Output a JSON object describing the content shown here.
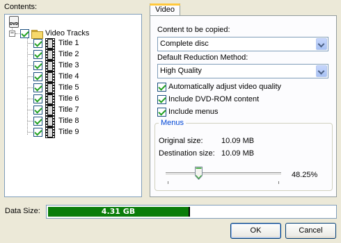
{
  "contents": {
    "label": "Contents:",
    "disc_icon_text": "DVD",
    "root": {
      "label": "Video Tracks",
      "checked": true,
      "expanded": true,
      "expander": "−"
    },
    "titles": [
      {
        "label": "Title 1",
        "checked": true
      },
      {
        "label": "Title 2",
        "checked": true
      },
      {
        "label": "Title 3",
        "checked": true
      },
      {
        "label": "Title 4",
        "checked": true
      },
      {
        "label": "Title 5",
        "checked": true
      },
      {
        "label": "Title 6",
        "checked": true
      },
      {
        "label": "Title 7",
        "checked": true
      },
      {
        "label": "Title 8",
        "checked": true
      },
      {
        "label": "Title 9",
        "checked": true
      }
    ]
  },
  "tabs": [
    {
      "label": "Video",
      "active": true
    }
  ],
  "video": {
    "content_label": "Content to be copied:",
    "content_value": "Complete disc",
    "reduction_label": "Default Reduction Method:",
    "reduction_value": "High Quality",
    "options": [
      {
        "label": "Automatically adjust video quality",
        "checked": true
      },
      {
        "label": "Include DVD-ROM content",
        "checked": true
      },
      {
        "label": "Include menus",
        "checked": true
      }
    ],
    "menus": {
      "legend": "Menus",
      "original_label": "Original size:",
      "original_value": "10.09 MB",
      "destination_label": "Destination size:",
      "destination_value": "10.09 MB",
      "slider_percent_label": "48.25%",
      "slider_fraction": 0.2825
    }
  },
  "data_size": {
    "label": "Data Size:",
    "value": "4.31 GB",
    "fill_fraction": 0.49,
    "fill_color": "#0a7d0a"
  },
  "buttons": {
    "ok": "OK",
    "cancel": "Cancel"
  },
  "colors": {
    "window_bg": "#ece9d8",
    "group_legend": "#0046d5",
    "tab_highlight": "#ffc83c"
  }
}
